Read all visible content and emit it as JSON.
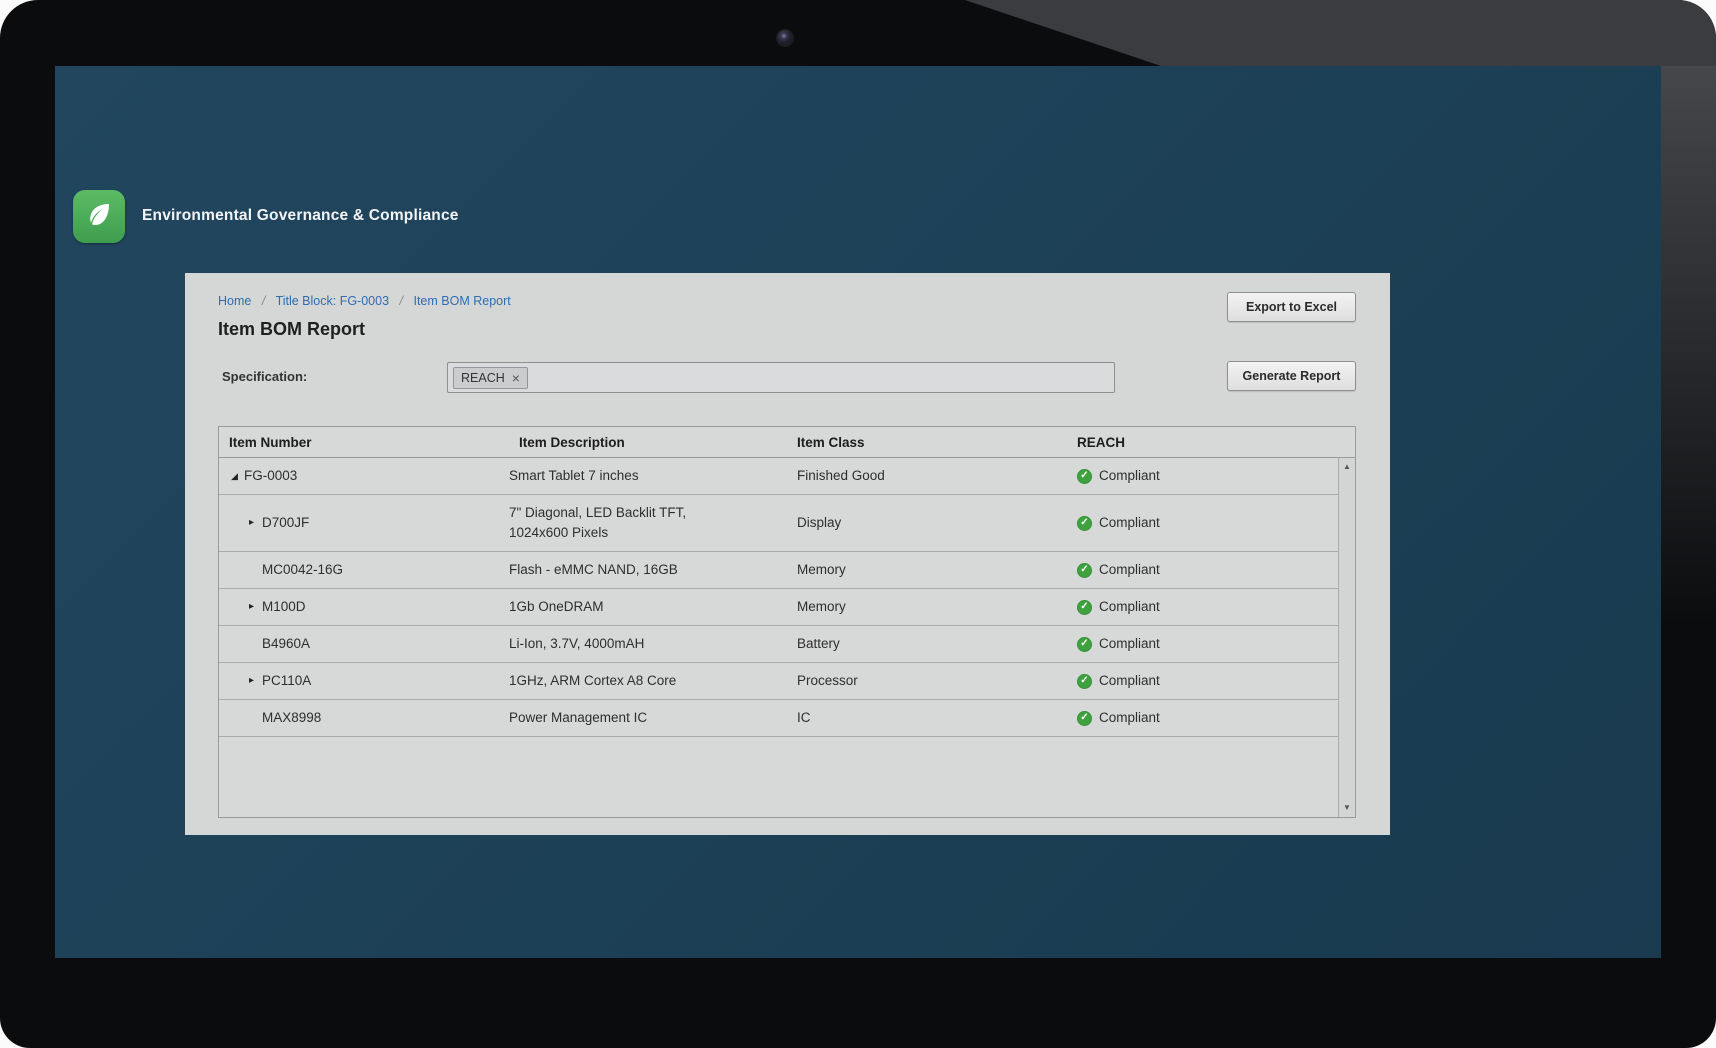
{
  "app": {
    "title": "Environmental Governance & Compliance"
  },
  "breadcrumb": {
    "items": [
      "Home",
      "Title Block: FG-0003",
      "Item BOM Report"
    ],
    "separator": "/"
  },
  "page": {
    "title": "Item BOM Report"
  },
  "toolbar": {
    "export_label": "Export to Excel",
    "generate_label": "Generate Report"
  },
  "filter": {
    "label": "Specification:",
    "tags": [
      {
        "label": "REACH",
        "remove_icon": "×"
      }
    ]
  },
  "icons": {
    "leaf": "leaf-icon",
    "expanded": "◢",
    "collapsed": "▸",
    "check": "✓",
    "scroll_up": "▲",
    "scroll_down": "▼",
    "tag_remove": "×"
  },
  "colors": {
    "screen_bg": "#1d4157",
    "panel_bg": "#d5d6d6",
    "link_blue": "#2f6db3",
    "brand_green": "#46a24c",
    "status_green": "#3fa23f"
  },
  "table": {
    "columns": [
      "Item Number",
      "Item Description",
      "Item Class",
      "REACH"
    ],
    "rows": [
      {
        "item_number": "FG-0003",
        "state": "expanded",
        "indent": 0,
        "description": "Smart Tablet 7 inches",
        "item_class": "Finished Good",
        "reach": "Compliant"
      },
      {
        "item_number": "D700JF",
        "state": "collapsed",
        "indent": 1,
        "description": "7\" Diagonal, LED Backlit TFT,\n1024x600 Pixels",
        "item_class": "Display",
        "reach": "Compliant"
      },
      {
        "item_number": "MC0042-16G",
        "state": "leaf",
        "indent": 1,
        "description": "Flash - eMMC NAND, 16GB",
        "item_class": "Memory",
        "reach": "Compliant"
      },
      {
        "item_number": "M100D",
        "state": "collapsed",
        "indent": 1,
        "description": "1Gb OneDRAM",
        "item_class": "Memory",
        "reach": "Compliant"
      },
      {
        "item_number": "B4960A",
        "state": "leaf",
        "indent": 1,
        "description": "Li-Ion, 3.7V, 4000mAH",
        "item_class": "Battery",
        "reach": "Compliant"
      },
      {
        "item_number": "PC110A",
        "state": "collapsed",
        "indent": 1,
        "description": "1GHz, ARM Cortex A8 Core",
        "item_class": "Processor",
        "reach": "Compliant"
      },
      {
        "item_number": "MAX8998",
        "state": "leaf",
        "indent": 1,
        "description": "Power Management IC",
        "item_class": "IC",
        "reach": "Compliant"
      }
    ]
  }
}
